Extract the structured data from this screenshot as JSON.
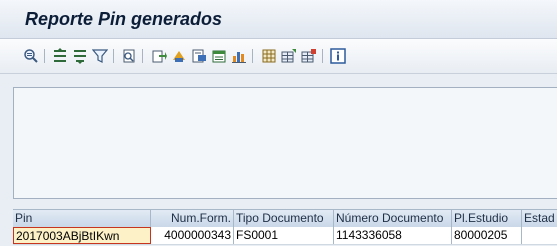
{
  "window": {
    "title": "Reporte Pin generados"
  },
  "toolbar": {
    "buttons": [
      {
        "name": "details-icon"
      },
      {
        "name": "sort-ascending-icon"
      },
      {
        "name": "sort-descending-icon"
      },
      {
        "name": "filter-icon"
      },
      {
        "name": "print-preview-icon"
      },
      {
        "name": "export-icon"
      },
      {
        "name": "spreadsheet-icon"
      },
      {
        "name": "word-processing-icon"
      },
      {
        "name": "local-file-icon"
      },
      {
        "name": "graphic-icon"
      },
      {
        "name": "change-layout-icon"
      },
      {
        "name": "choose-layout-icon"
      },
      {
        "name": "save-layout-icon"
      },
      {
        "name": "info-icon"
      }
    ]
  },
  "table": {
    "columns": [
      "Pin",
      "Num.Form.",
      "Tipo Documento",
      "Número Documento",
      "Pl.Estudio",
      "Estad"
    ],
    "rows": [
      [
        "2017003ABjBtIKwn",
        "4000000343",
        "FS0001",
        "1143336058",
        "80000205",
        ""
      ]
    ]
  }
}
